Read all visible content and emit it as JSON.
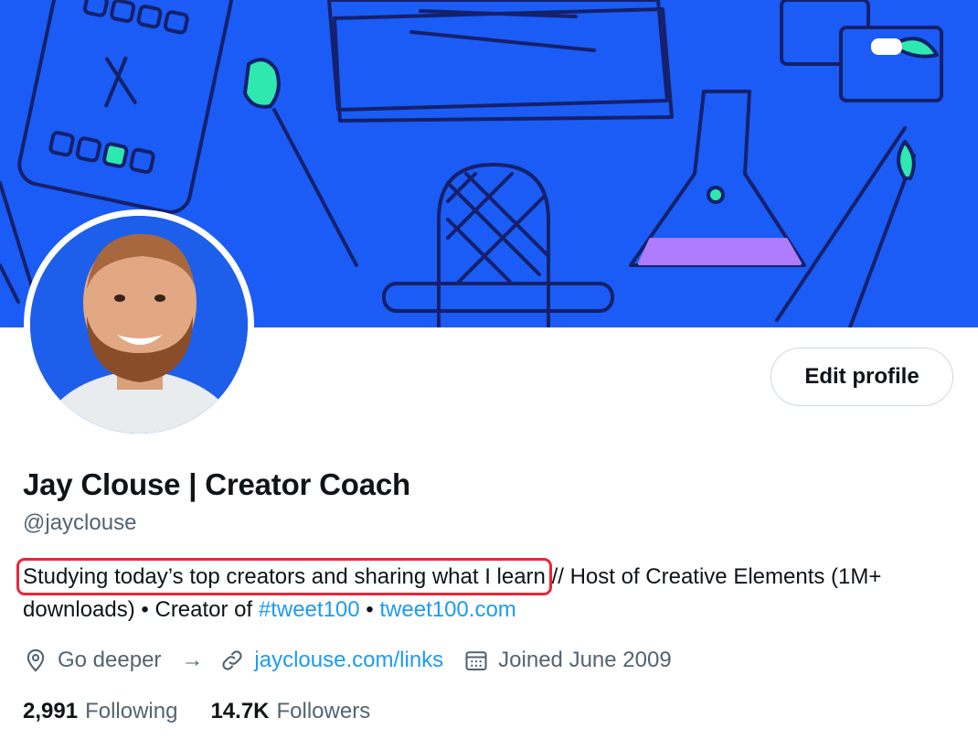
{
  "profile": {
    "display_name": "Jay Clouse | Creator Coach",
    "handle": "@jayclouse",
    "edit_button_label": "Edit profile",
    "bio": {
      "highlighted": "Studying today’s top creators and sharing what I learn",
      "part2": "// Host of Creative Elements (1M+ downloads) • Creator of ",
      "hashtag": "#tweet100",
      "separator": " • ",
      "link": "tweet100.com"
    },
    "meta": {
      "location": "Go deeper",
      "arrow": "→",
      "url": "jayclouse.com/links",
      "joined": "Joined June 2009"
    },
    "stats": {
      "following_count": "2,991",
      "following_label": "Following",
      "followers_count": "14.7K",
      "followers_label": "Followers"
    }
  },
  "colors": {
    "banner": "#1a5cf5",
    "link": "#1d9bf0",
    "highlight_box": "#e8263a",
    "secondary_text": "#536471"
  },
  "icons": {
    "location": "location-pin-icon",
    "url": "link-icon",
    "joined": "calendar-icon"
  }
}
